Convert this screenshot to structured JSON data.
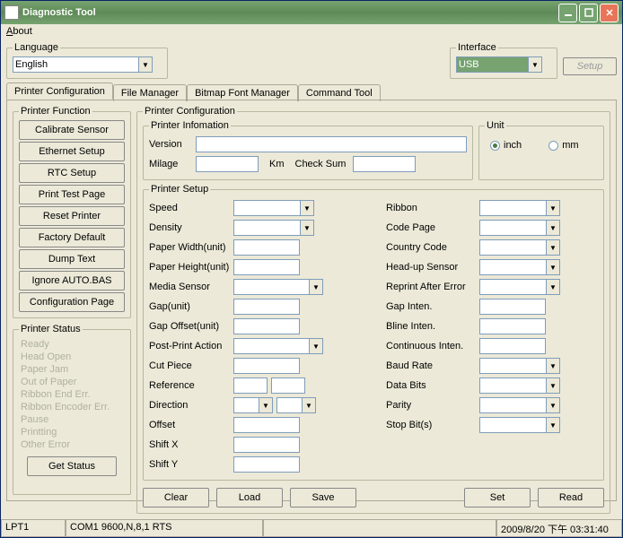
{
  "titlebar": {
    "title": "Diagnostic Tool"
  },
  "menu": {
    "about": "About",
    "about_u": "A"
  },
  "language_group": {
    "legend": "Language",
    "value": "English"
  },
  "interface_group": {
    "legend": "Interface",
    "value": "USB",
    "setup": "Setup"
  },
  "tabs": {
    "printer_config": "Printer Configuration",
    "file_manager": "File Manager",
    "bitmap_font": "Bitmap Font Manager",
    "command_tool": "Command Tool"
  },
  "printer_function": {
    "legend": "Printer Function",
    "buttons": {
      "calibrate": "Calibrate Sensor",
      "ethernet": "Ethernet Setup",
      "rtc": "RTC Setup",
      "testpage": "Print Test Page",
      "reset": "Reset Printer",
      "factory": "Factory Default",
      "dump": "Dump Text",
      "ignore": "Ignore AUTO.BAS",
      "configpage": "Configuration Page"
    }
  },
  "printer_status": {
    "legend": "Printer Status",
    "items": {
      "ready": "Ready",
      "headopen": "Head Open",
      "paperjam": "Paper Jam",
      "outofpaper": "Out of Paper",
      "ribbonend": "Ribbon End Err.",
      "ribbonenc": "Ribbon Encoder Err.",
      "pause": "Pause",
      "printing": "Printting",
      "other": "Other Error"
    },
    "getstatus": "Get Status"
  },
  "printer_config_group": {
    "legend": "Printer Configuration",
    "info_legend": "Printer Infomation",
    "version": "Version",
    "milage": "Milage",
    "km": "Km",
    "checksum": "Check Sum",
    "setup_legend": "Printer Setup",
    "labels": {
      "speed": "Speed",
      "density": "Density",
      "paperw": "Paper Width(unit)",
      "paperh": "Paper Height(unit)",
      "media": "Media Sensor",
      "gap": "Gap(unit)",
      "gapoff": "Gap Offset(unit)",
      "postprint": "Post-Print Action",
      "cutpiece": "Cut Piece",
      "reference": "Reference",
      "direction": "Direction",
      "offset": "Offset",
      "shiftx": "Shift X",
      "shifty": "Shift Y",
      "ribbon": "Ribbon",
      "codepage": "Code Page",
      "country": "Country Code",
      "headup": "Head-up Sensor",
      "reprint": "Reprint After Error",
      "gapinten": "Gap Inten.",
      "blineinten": "Bline Inten.",
      "continten": "Continuous Inten.",
      "baud": "Baud Rate",
      "databits": "Data Bits",
      "parity": "Parity",
      "stopbits": "Stop Bit(s)"
    },
    "unit_legend": "Unit",
    "unit_inch": "inch",
    "unit_mm": "mm",
    "buttons": {
      "clear": "Clear",
      "load": "Load",
      "save": "Save",
      "set": "Set",
      "read": "Read"
    }
  },
  "statusbar": {
    "port": "LPT1",
    "com": "COM1 9600,N,8,1 RTS",
    "datetime": "2009/8/20 下午 03:31:40"
  }
}
